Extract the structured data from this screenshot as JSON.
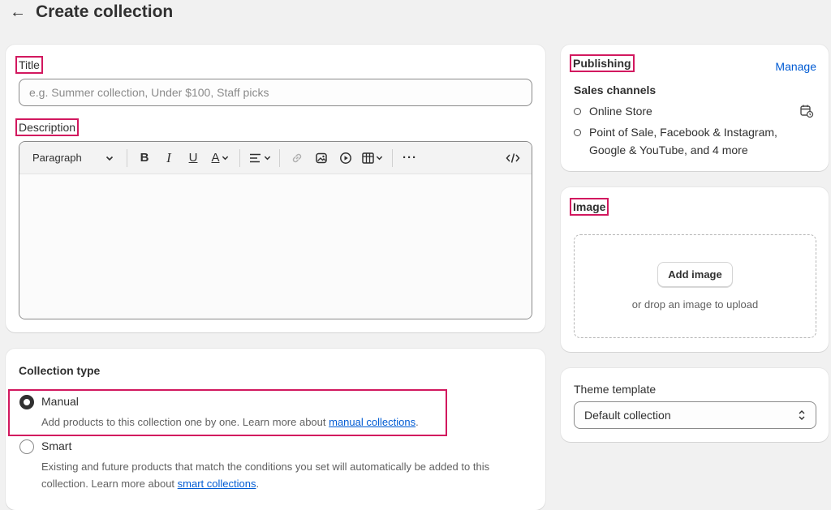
{
  "header": {
    "back_icon": "arrow-left-icon",
    "title": "Create collection"
  },
  "title_field": {
    "label": "Title",
    "placeholder": "e.g. Summer collection, Under $100, Staff picks",
    "value": ""
  },
  "description": {
    "label": "Description",
    "toolbar": {
      "paragraph_label": "Paragraph"
    }
  },
  "collection_type": {
    "title": "Collection type",
    "manual": {
      "label": "Manual",
      "help": "Add products to this collection one by one. Learn more about ",
      "link": "manual collections",
      "suffix": "."
    },
    "smart": {
      "label": "Smart",
      "help_line1": "Existing and future products that match the conditions you set will automatically be added to this",
      "help_line2": "collection. Learn more about ",
      "link": "smart collections",
      "suffix": "."
    },
    "selected": "Manual"
  },
  "publishing": {
    "title": "Publishing",
    "manage_label": "Manage",
    "sales_channels_label": "Sales channels",
    "channels": [
      "Online Store",
      "Point of Sale, Facebook & Instagram, Google & YouTube, and 4 more"
    ]
  },
  "image": {
    "title": "Image",
    "add_button": "Add image",
    "drop_text": "or drop an image to upload"
  },
  "theme": {
    "label": "Theme template",
    "selected": "Default collection"
  },
  "colors": {
    "highlight": "#d2185f",
    "link": "#005bd3",
    "background": "#f1f1f1"
  }
}
